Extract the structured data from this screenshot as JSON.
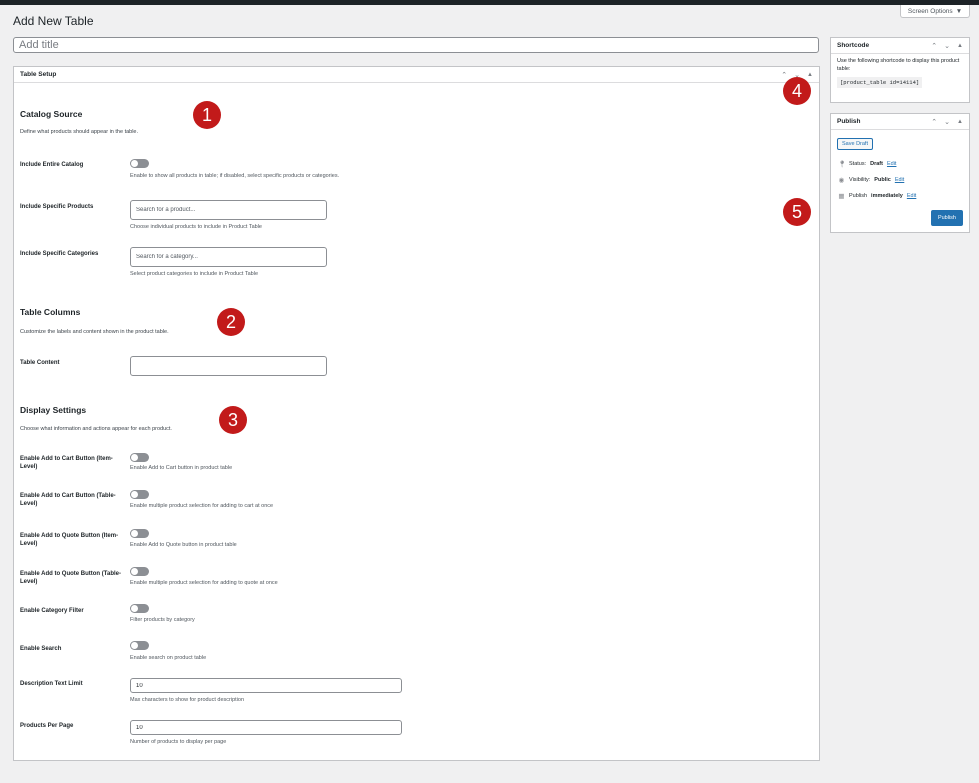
{
  "page": {
    "title": "Add New Table",
    "screen_options": "Screen Options",
    "title_placeholder": "Add title"
  },
  "table_setup": {
    "header": "Table Setup",
    "catalog": {
      "title": "Catalog Source",
      "desc": "Define what products should appear in the table.",
      "entire_label": "Include Entire Catalog",
      "entire_help": "Enable to show all products in table; if disabled, select specific products or categories.",
      "products_label": "Include Specific Products",
      "products_placeholder": "Search for a product...",
      "products_help": "Choose individual products to include in Product Table",
      "categories_label": "Include Specific Categories",
      "categories_placeholder": "Search for a category...",
      "categories_help": "Select product categories to include in Product Table"
    },
    "columns": {
      "title": "Table Columns",
      "desc": "Customize the labels and content shown in the product table.",
      "content_label": "Table Content"
    },
    "display": {
      "title": "Display Settings",
      "desc": "Choose what information and actions appear for each product.",
      "items": [
        {
          "label": "Enable Add to Cart Button (Item-Level)",
          "help": "Enable Add to Cart button in product table"
        },
        {
          "label": "Enable Add to Cart Button (Table-Level)",
          "help": "Enable multiple product selection for adding to cart at once"
        },
        {
          "label": "Enable Add to Quote Button (Item-Level)",
          "help": "Enable Add to Quote button in product table"
        },
        {
          "label": "Enable Add to Quote Button (Table-Level)",
          "help": "Enable multiple product selection for adding to quote at once"
        },
        {
          "label": "Enable Category Filter",
          "help": "Filter products by category"
        },
        {
          "label": "Enable Search",
          "help": "Enable search on product table"
        }
      ],
      "desc_limit_label": "Description Text Limit",
      "desc_limit_value": "10",
      "desc_limit_help": "Max characters to show for product description",
      "per_page_label": "Products Per Page",
      "per_page_value": "10",
      "per_page_help": "Number of products to display per page"
    }
  },
  "shortcode": {
    "header": "Shortcode",
    "text": "Use the following shortcode to display this product table:",
    "code": "[product_table id=14114]"
  },
  "publish": {
    "header": "Publish",
    "save_draft": "Save Draft",
    "status_label": "Status:",
    "status_value": "Draft",
    "visibility_label": "Visibility:",
    "visibility_value": "Public",
    "publish_label": "Publish",
    "publish_value": "immediately",
    "edit": "Edit",
    "publish_button": "Publish"
  },
  "badges": [
    "1",
    "2",
    "3",
    "4",
    "5"
  ],
  "colors": {
    "accent": "#2271b1",
    "badge": "#c21a1a",
    "background": "#f0f0f1"
  },
  "icons": [
    "chevron-up-icon",
    "chevron-down-icon",
    "caret-up-icon",
    "pin-icon",
    "eye-icon",
    "calendar-icon",
    "screen-options-arrow-icon"
  ]
}
